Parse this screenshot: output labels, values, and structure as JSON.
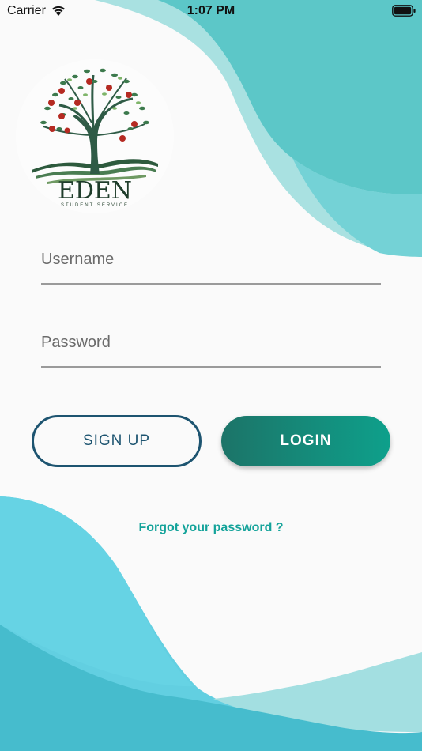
{
  "status_bar": {
    "carrier": "Carrier",
    "time": "1:07 PM",
    "wifi_icon": "wifi-icon",
    "battery_icon": "battery-icon"
  },
  "logo": {
    "name": "EDEN",
    "tagline": "STUDENT SERVICE",
    "icon": "apple-tree-icon"
  },
  "form": {
    "username_placeholder": "Username",
    "username_value": "",
    "password_placeholder": "Password",
    "password_value": ""
  },
  "buttons": {
    "signup_label": "SIGN UP",
    "login_label": "LOGIN"
  },
  "links": {
    "forgot_password": "Forgot your password ?"
  },
  "colors": {
    "background": "#fafafa",
    "wave_teal": "#5cc8c8",
    "wave_light": "#a8e0e0",
    "wave_blue": "#62d0e0",
    "accent_dark_blue": "#1d5470",
    "login_gradient_start": "#1c7468",
    "login_gradient_end": "#0ea08b",
    "link_color": "#14a39a"
  }
}
